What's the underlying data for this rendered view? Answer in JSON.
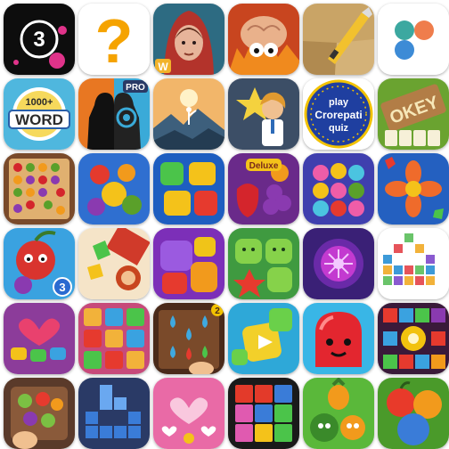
{
  "grid": {
    "rows": 6,
    "cols": 6,
    "apps": [
      {
        "id": "app-01",
        "icon": "number-3-circle-icon",
        "text": "3",
        "colors": [
          "#111111",
          "#e0338a"
        ]
      },
      {
        "id": "app-02",
        "icon": "question-mark-icon",
        "text": "?",
        "colors": [
          "#ffffff",
          "#f5a300"
        ]
      },
      {
        "id": "app-03",
        "icon": "hooded-girl-portrait-icon",
        "text": "W",
        "colors": [
          "#2d6b82",
          "#b3332b"
        ]
      },
      {
        "id": "app-04",
        "icon": "brain-monster-fire-icon",
        "colors": [
          "#c8451f",
          "#e9b18b"
        ]
      },
      {
        "id": "app-05",
        "icon": "box-cutter-cardboard-icon",
        "colors": [
          "#c9a466",
          "#f2c12e"
        ]
      },
      {
        "id": "app-06",
        "icon": "three-dots-icon",
        "colors": [
          "#ffffff",
          "#3ca8a0",
          "#ef7d4c",
          "#3d8bd6"
        ]
      },
      {
        "id": "app-07",
        "icon": "word-game-icon",
        "text_top": "1000+",
        "text_main": "WORD",
        "colors": [
          "#4fb7de",
          "#ffffff"
        ]
      },
      {
        "id": "app-08",
        "icon": "silhouette-target-icon",
        "badge": "PRO",
        "colors": [
          "#e87722",
          "#3aaad8"
        ]
      },
      {
        "id": "app-09",
        "icon": "stick-figure-mountain-icon",
        "colors": [
          "#f2b66a",
          "#3d5f7c"
        ]
      },
      {
        "id": "app-10",
        "icon": "star-professor-icon",
        "colors": [
          "#3c4e66",
          "#f4d23e"
        ]
      },
      {
        "id": "app-11",
        "icon": "crorepati-quiz-icon",
        "text_line1": "play",
        "text_line2": "Crorepati",
        "text_line3": "quiz",
        "colors": [
          "#1f3fa0",
          "#f2c200"
        ]
      },
      {
        "id": "app-12",
        "icon": "okey-tiles-icon",
        "text": "OKEY",
        "colors": [
          "#6aa330",
          "#b27d46"
        ]
      },
      {
        "id": "app-13",
        "icon": "fruit-board-icon",
        "colors": [
          "#7a4a2a",
          "#e0b070"
        ]
      },
      {
        "id": "app-14",
        "icon": "fruit-match-icon",
        "colors": [
          "#2f6fd0",
          "#e43a2d"
        ]
      },
      {
        "id": "app-15",
        "icon": "jelly-blocks-icon",
        "colors": [
          "#1e5ec0",
          "#f4c21a"
        ]
      },
      {
        "id": "app-16",
        "icon": "fruit-deluxe-icon",
        "text": "Deluxe",
        "colors": [
          "#6a2a8a",
          "#d4252c"
        ]
      },
      {
        "id": "app-17",
        "icon": "cake-match-icon",
        "colors": [
          "#3f3fae",
          "#ef5da8"
        ]
      },
      {
        "id": "app-18",
        "icon": "flower-gem-icon",
        "colors": [
          "#2460c0",
          "#ef6b2b"
        ]
      },
      {
        "id": "app-19",
        "icon": "cherry-heroes-icon",
        "badge": "3",
        "colors": [
          "#3aa2e0",
          "#d9342e"
        ]
      },
      {
        "id": "app-20",
        "icon": "soldier-candy-icon",
        "colors": [
          "#d03a2a",
          "#f5e4c8"
        ]
      },
      {
        "id": "app-21",
        "icon": "jelly-cubes-icon",
        "colors": [
          "#7c2fb8",
          "#f0c418"
        ]
      },
      {
        "id": "app-22",
        "icon": "happy-jelly-icon",
        "colors": [
          "#3f9a40",
          "#86d24a"
        ]
      },
      {
        "id": "app-23",
        "icon": "purple-orb-icon",
        "colors": [
          "#3a2076",
          "#c33ad0"
        ]
      },
      {
        "id": "app-24",
        "icon": "pastel-blocks-icon",
        "colors": [
          "#ffffff",
          "#3d9ad8"
        ]
      },
      {
        "id": "app-25",
        "icon": "candy-heart-icon",
        "colors": [
          "#8c3c9a",
          "#e9416e"
        ]
      },
      {
        "id": "app-26",
        "icon": "flower-tiles-icon",
        "colors": [
          "#c74a7a",
          "#f2b23a"
        ]
      },
      {
        "id": "app-27",
        "icon": "water-drop-board-icon",
        "text": "2",
        "colors": [
          "#4a2a1a",
          "#3fa9e0"
        ]
      },
      {
        "id": "app-28",
        "icon": "green-jelly-block-icon",
        "colors": [
          "#2ea8d8",
          "#f2d02a"
        ]
      },
      {
        "id": "app-29",
        "icon": "red-jelly-face-icon",
        "colors": [
          "#39b6e6",
          "#e3262f"
        ]
      },
      {
        "id": "app-30",
        "icon": "gem-block-burst-icon",
        "colors": [
          "#3a1a3a",
          "#f2c20e"
        ]
      },
      {
        "id": "app-31",
        "icon": "fruit-basket-icon",
        "colors": [
          "#5a3a2a",
          "#7bc043"
        ]
      },
      {
        "id": "app-32",
        "icon": "falling-blocks-icon",
        "colors": [
          "#2a3a66",
          "#3a7cd8"
        ]
      },
      {
        "id": "app-33",
        "icon": "candy-hearts-icon",
        "colors": [
          "#e96aa6",
          "#f9c8de"
        ]
      },
      {
        "id": "app-34",
        "icon": "color-block-grid-icon",
        "colors": [
          "#1a1a1a",
          "#e33a2a"
        ]
      },
      {
        "id": "app-35",
        "icon": "fruit-friends-icon",
        "colors": [
          "#5ab83a",
          "#f29a1c"
        ]
      },
      {
        "id": "app-36",
        "icon": "fresh-fruit-icon",
        "colors": [
          "#4a9a2a",
          "#e83a2a"
        ]
      }
    ]
  }
}
